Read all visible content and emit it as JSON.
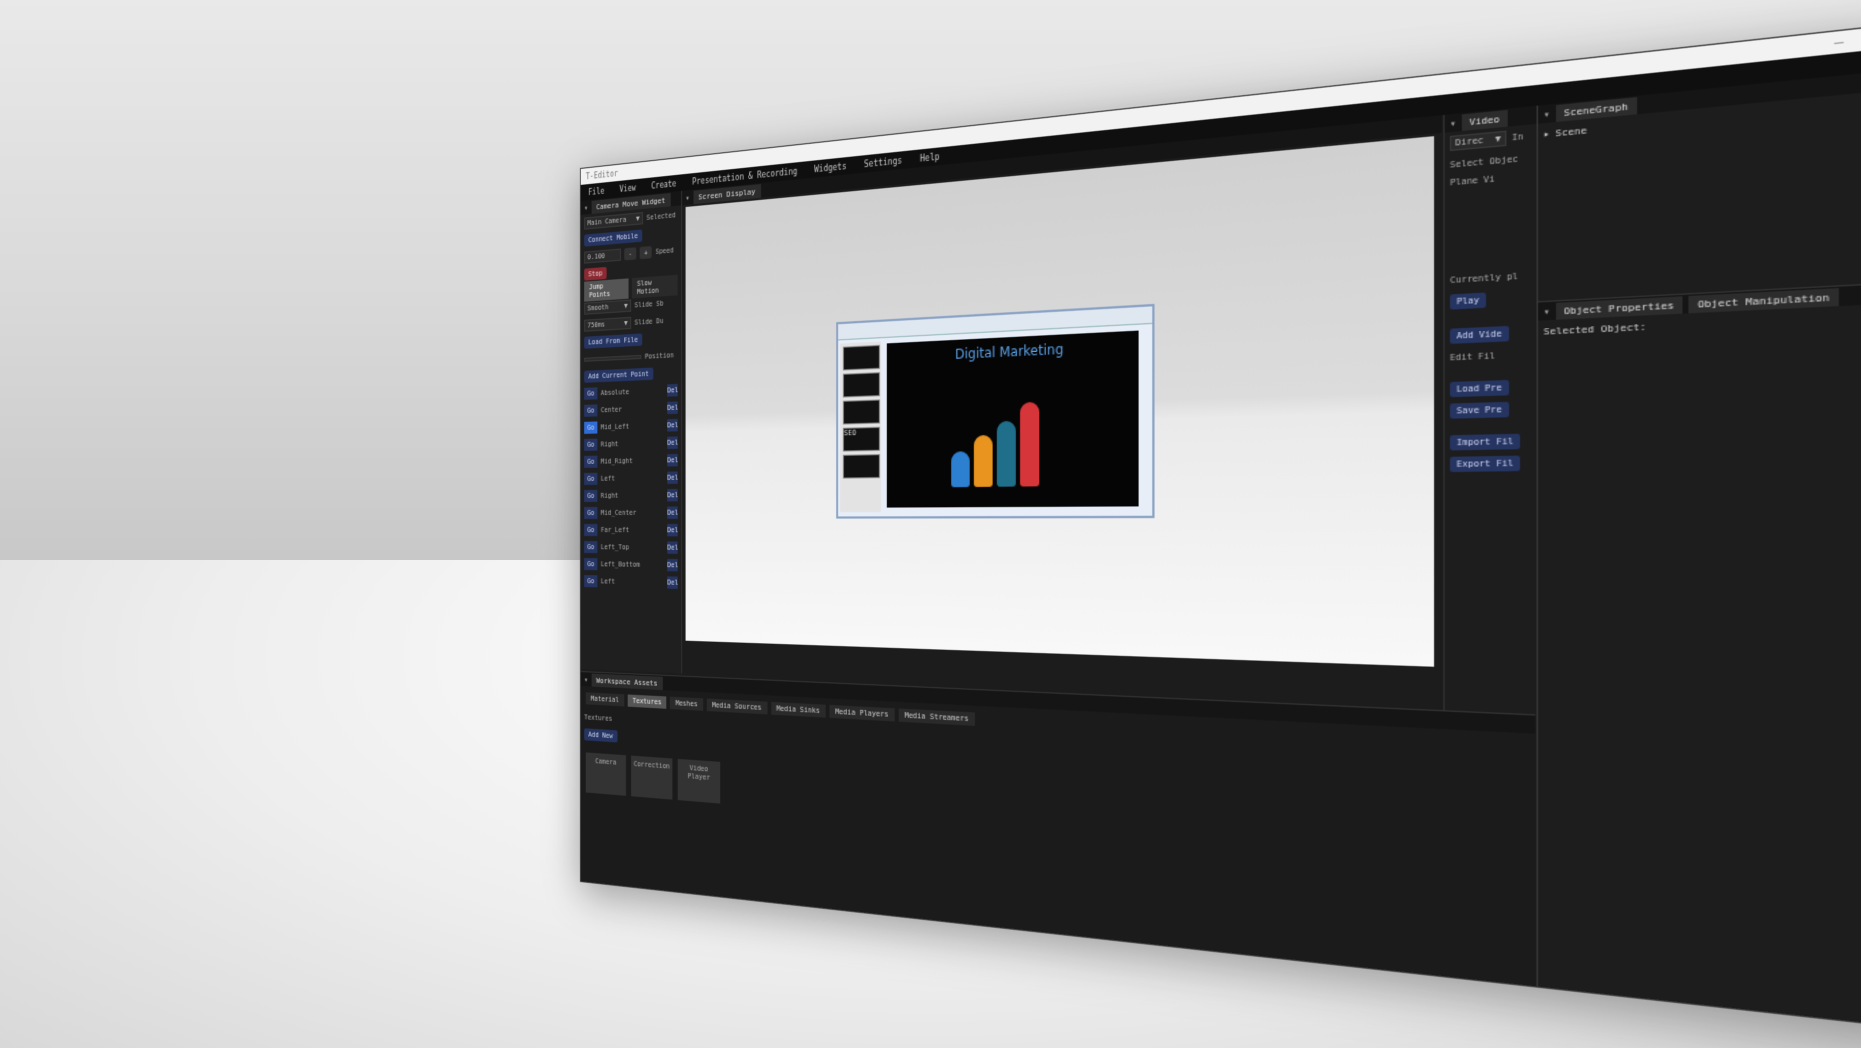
{
  "window": {
    "title": "T-Editor",
    "min": "–",
    "max": "❐",
    "close": "✕"
  },
  "menu": [
    "File",
    "View",
    "Create",
    "Presentation & Recording",
    "Widgets",
    "Settings",
    "Help"
  ],
  "camera_widget": {
    "title": "Camera Move Widget",
    "camera_select": "Main Camera",
    "selected_label": "Selected",
    "connect_mobile": "Connect Mobile",
    "speed_value": "0.100",
    "minus": "-",
    "plus": "+",
    "speed_label": "Speed",
    "stop": "Stop",
    "jump_points": "Jump Points",
    "slow_motion": "Slow Motion",
    "smooth_select": "Smooth",
    "slide_sb_label": "Slide Sb",
    "ms_select": "750ms",
    "slide_du_label": "Slide Du",
    "load_from_file": "Load From File",
    "position_label": "Position",
    "add_current_point": "Add Current Point",
    "go_label": "Go",
    "del_label": "Del",
    "points": [
      "Absolute",
      "Center",
      "Mid_Left",
      "Right",
      "Mid_Right",
      "Left",
      "Right",
      "Mid_Center",
      "Far_Left",
      "Left_Top",
      "Left_Bottom",
      "Left"
    ]
  },
  "screen_display": {
    "title": "Screen Display",
    "slide_title": "Digital Marketing",
    "thumb_text": "SEO"
  },
  "video_panel": {
    "title": "Video",
    "direct": "Direc",
    "in": "In",
    "select_object": "Select Objec",
    "plane": "Plane",
    "vi": "Vi",
    "currently_playing": "Currently pl",
    "play": "Play",
    "add_video": "Add Vide",
    "edit_file": "Edit Fil",
    "load_preset": "Load Pre",
    "save_preset": "Save Pre",
    "import_file": "Import Fil",
    "export_file": "Export Fil"
  },
  "scenegraph": {
    "title": "SceneGraph",
    "root": "Scene"
  },
  "properties": {
    "tab1": "Object Properties",
    "tab2": "Object Manipulation",
    "selected": "Selected Object:"
  },
  "assets": {
    "title": "Workspace Assets",
    "tabs": [
      "Material",
      "Textures",
      "Meshes",
      "Media Sources",
      "Media Sinks",
      "Media Players",
      "Media Streamers"
    ],
    "section": "Textures",
    "add_new": "Add New",
    "tiles": [
      "Camera",
      "Correction",
      "Video Player"
    ]
  },
  "colors": {
    "accent": "#253461",
    "active": "#2f6cd6",
    "stop": "#8b2a33",
    "slide_title": "#5aa0e6"
  }
}
